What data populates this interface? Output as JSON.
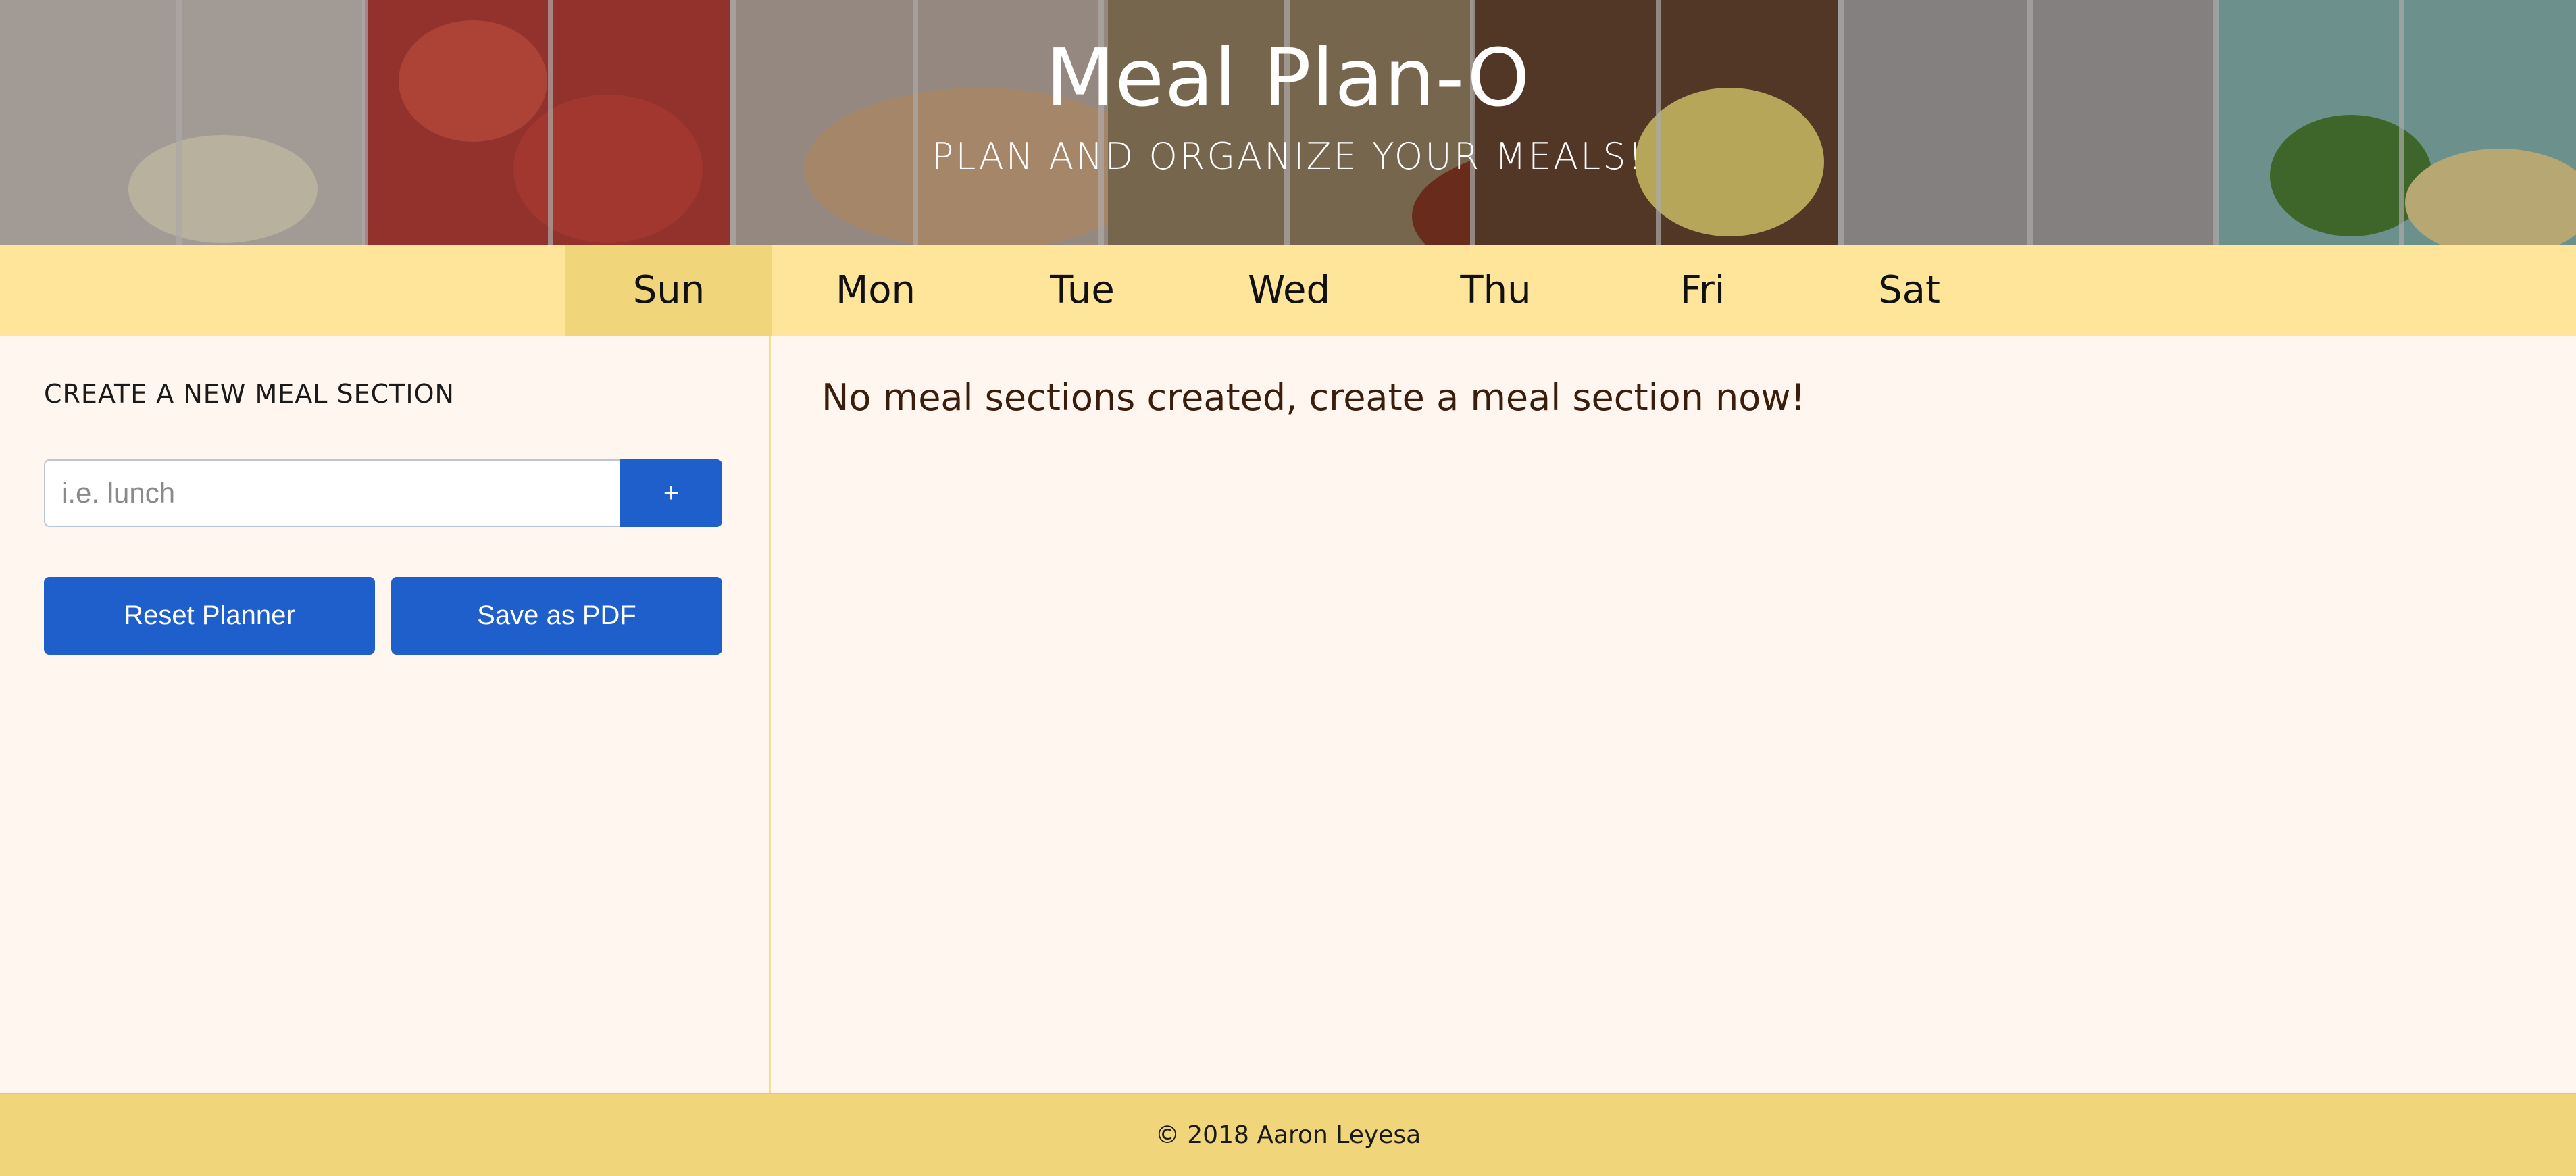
{
  "header": {
    "title": "Meal Plan-O",
    "subtitle": "PLAN AND ORGANIZE YOUR MEALS!"
  },
  "days": [
    {
      "label": "Sun",
      "active": true
    },
    {
      "label": "Mon",
      "active": false
    },
    {
      "label": "Tue",
      "active": false
    },
    {
      "label": "Wed",
      "active": false
    },
    {
      "label": "Thu",
      "active": false
    },
    {
      "label": "Fri",
      "active": false
    },
    {
      "label": "Sat",
      "active": false
    }
  ],
  "sidebar": {
    "heading": "CREATE A NEW MEAL SECTION",
    "input_placeholder": "i.e. lunch",
    "input_value": "",
    "add_label": "+",
    "reset_label": "Reset Planner",
    "pdf_label": "Save as PDF"
  },
  "main": {
    "empty_message": "No meal sections created, create a meal section now!"
  },
  "footer": {
    "copyright": "© 2018 Aaron Leyesa"
  },
  "colors": {
    "nav_bg": "#ffe59a",
    "nav_active": "#f0d57a",
    "page_bg": "#fff7ef",
    "button_blue": "#1f5fcc",
    "footer_bg": "#f0d57a"
  }
}
